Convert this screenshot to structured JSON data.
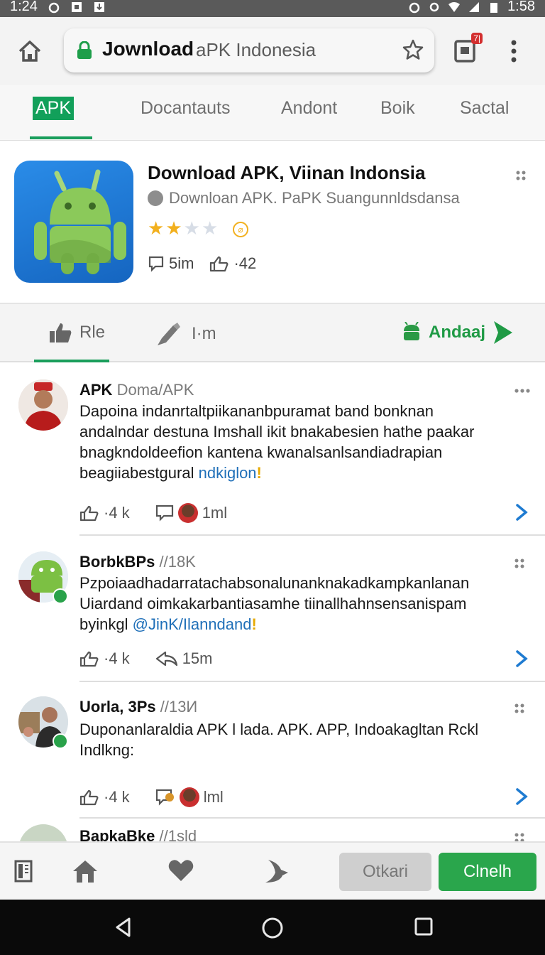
{
  "status_bar": {
    "time_left": "1:24",
    "time_right": "1:58"
  },
  "toolbar": {
    "url_strong": "Jownload",
    "url_rest": "aPK Indonesia",
    "tab_badge": "7|"
  },
  "nav_tabs": [
    "APK",
    "Docantauts",
    "Andont",
    "Boik",
    "Sactal"
  ],
  "app": {
    "title": "Download APK, Viinan Indonsia",
    "subtitle": "Downloan APK. PaPK Suangunnldsdansa",
    "rating_stars": 2,
    "rating_max": 5,
    "comments": "5im",
    "likes": "·42"
  },
  "actions": {
    "like_label": "Rle",
    "tool_label": "I·m",
    "android_label": "Andaaj"
  },
  "posts": [
    {
      "name": "APK",
      "handle": "Doma/APK",
      "body": "Dapoina indanrtaltpiikananbpuramat band bonknan andalndar destuna Imshall ikit bnakabesien hathe paakar bnagkndoldeefion kantena kwanalsanlsandiadrapian beagiiabestgural",
      "link": "ndkiglon",
      "mark": "!",
      "likes": "·4 k",
      "extra": "1ml"
    },
    {
      "name": "BorbkBPs",
      "handle": "//18K",
      "body": "Pzpoiaadhadarratachabsonalunanknakadkampkanlanan Uiardand oimkakarbantiasamhe tiinallhahnsensanispam byinkgl",
      "link": "@JinK/Ilanndand",
      "mark": "!",
      "likes": "·4 k",
      "extra": "15m"
    },
    {
      "name": "Uorla, 3Ps",
      "handle": "//13И",
      "body": "Duponanlaraldia APK l lada. APK. APP, Indoakagltan Rckl Indlkng:",
      "link": "",
      "mark": "",
      "likes": "·4 k",
      "extra": "lml"
    },
    {
      "name": "BapkaBke",
      "handle": "//1sld"
    }
  ],
  "bottom": {
    "gray_button": "Otkari",
    "green_button": "Clnelh"
  }
}
